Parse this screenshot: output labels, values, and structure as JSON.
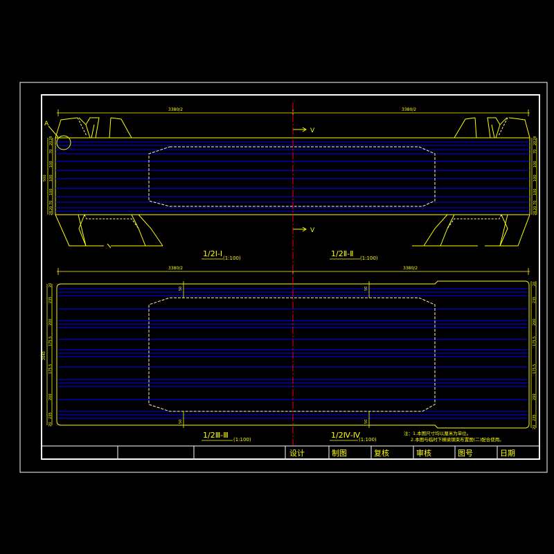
{
  "markers": {
    "detail": "A",
    "cut_top": "V",
    "cut_bottom": "V"
  },
  "top_dims": {
    "left": "3380/2",
    "right": "3380/2"
  },
  "bottom_dims": {
    "left": "3380/2",
    "right": "3380/2"
  },
  "left_chain_top": {
    "total": "500",
    "parts": [
      "28",
      "20",
      "70",
      "100",
      "100",
      "100",
      "70",
      "20",
      "28"
    ]
  },
  "right_chain_top": {
    "parts": [
      "28",
      "20",
      "70",
      "100",
      "100",
      "100",
      "70",
      "20",
      "28"
    ]
  },
  "left_chain_bottom": {
    "total": "2040",
    "parts": [
      "20",
      "235",
      "200",
      "175.5",
      "175.5",
      "200",
      "235",
      "20"
    ]
  },
  "right_chain_bottom": {
    "parts": [
      "20",
      "235",
      "200",
      "175.5",
      "175.5",
      "200",
      "235",
      "20"
    ]
  },
  "small_dims": {
    "a": "50",
    "b": "50",
    "c": "50",
    "d": "50"
  },
  "sections": {
    "s1": {
      "label": "1/2Ⅰ-Ⅰ",
      "scale": "(1:100)"
    },
    "s2": {
      "label": "1/2Ⅱ-Ⅱ",
      "scale": "(1:100)"
    },
    "s3": {
      "label": "1/2Ⅲ-Ⅲ",
      "scale": "(1:100)"
    },
    "s4": {
      "label": "1/2Ⅳ-Ⅳ",
      "scale": "(1:100)"
    }
  },
  "notes": {
    "line1": "注：1.本图尺寸均以厘米为单位。",
    "line2": "2.本图与临时下横梁钢束布置图(二)配合使用。"
  },
  "title_block": {
    "design": "设计",
    "draft": "制图",
    "review": "复核",
    "approve": "审核",
    "drawing_no": "图号",
    "date": "日期"
  },
  "colors": {
    "background": "#000000",
    "frame": "#ffffff",
    "outline": "#ffff00",
    "tendon": "#0000ff",
    "centerline": "#ff0000",
    "hidden_box": "#ffffaa"
  }
}
